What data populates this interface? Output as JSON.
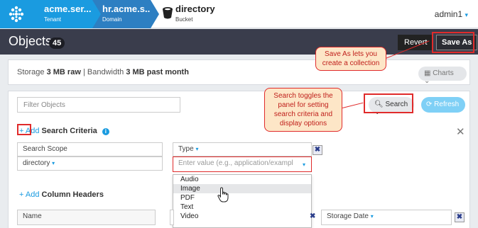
{
  "breadcrumb": {
    "tenant": {
      "title": "acme.ser...",
      "subtitle": "Tenant"
    },
    "domain": {
      "title": "hr.acme.s..",
      "subtitle": "Domain"
    },
    "bucket": {
      "title": "directory",
      "subtitle": "Bucket"
    }
  },
  "user": {
    "name": "admin1",
    "caret": "▾"
  },
  "header": {
    "title": "Objects",
    "count": "45",
    "revert_label": "Revert",
    "save_as_label": "Save As"
  },
  "storage": {
    "storage_label": "Storage",
    "storage_value": "3 MB raw",
    "separator": "|",
    "bandwidth_label": "Bandwidth",
    "bandwidth_value": "3 MB past month",
    "charts_label": "Charts"
  },
  "filter": {
    "placeholder": "Filter Objects",
    "search_label": "Search",
    "refresh_label": "Refresh",
    "add_label": "Add",
    "search_criteria_label": "Search Criteria",
    "scope_label": "Search Scope",
    "scope_value": "directory",
    "type_label": "Type",
    "value_placeholder": "Enter value (e.g., application/exampl",
    "type_options": [
      "Audio",
      "Image",
      "PDF",
      "Text",
      "Video"
    ],
    "hovered_option": "Image",
    "add_column_label": "Add",
    "column_headers_label": "Column Headers",
    "name_column": "Name",
    "storage_date_column": "Storage Date"
  },
  "callouts": {
    "save_as": "Save As lets you create a collection",
    "search": "Search toggles the panel for setting search criteria and display options"
  },
  "colors": {
    "accent": "#1a9be0",
    "header_dark": "#3a3d4c",
    "annotation_red": "#e02b2b",
    "callout_bg": "#fde6c7"
  }
}
